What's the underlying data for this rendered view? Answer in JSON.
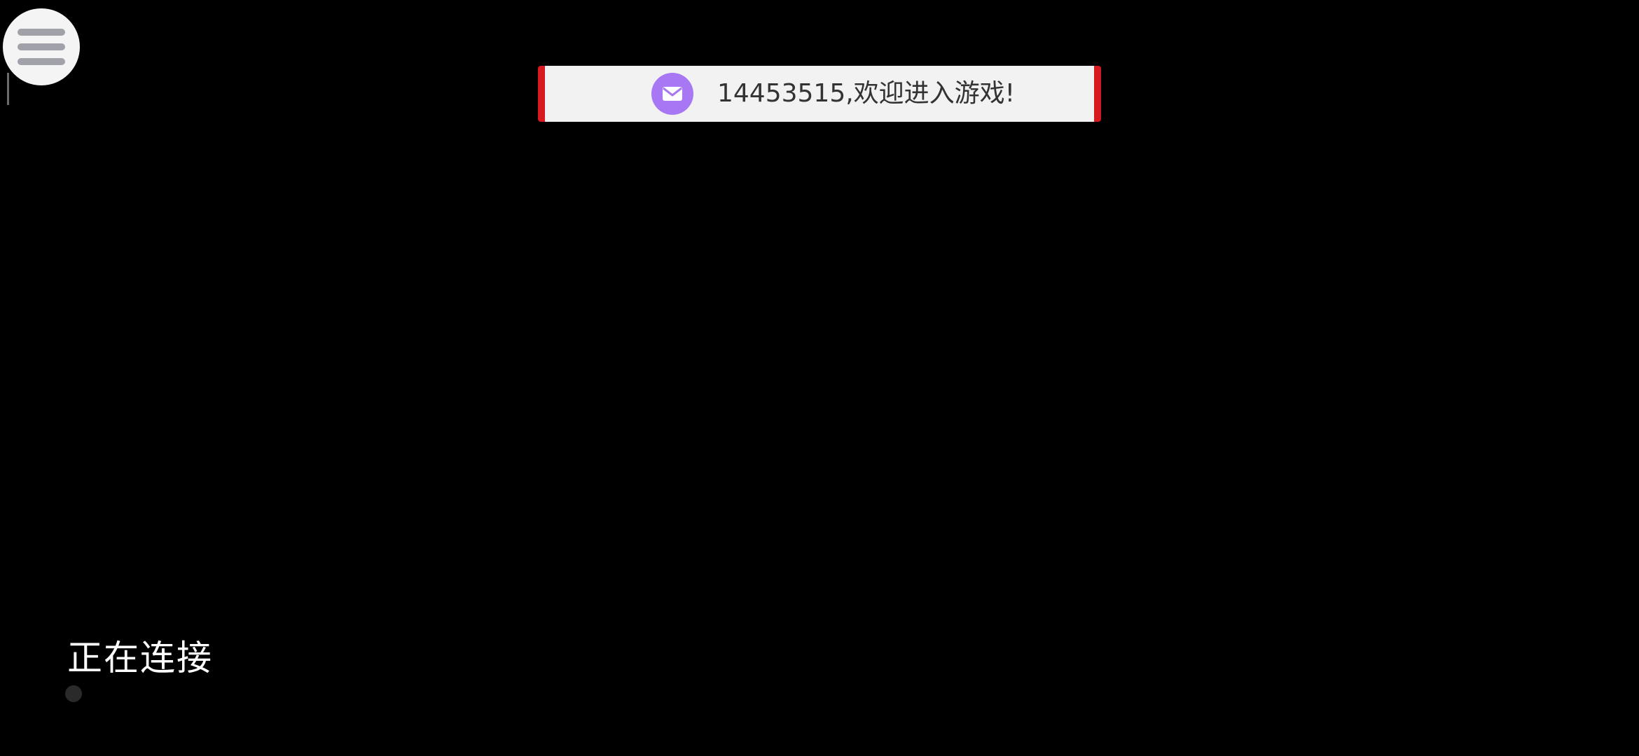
{
  "menu": {
    "icon": "hamburger-icon",
    "background": "#f4f4f4",
    "bar_color": "#a1a1a9"
  },
  "notification": {
    "icon": "mail-icon",
    "icon_color": "#a877f4",
    "accent": "#d71a20",
    "message": "14453515,欢迎进入游戏!"
  },
  "status": {
    "text": "正在连接"
  }
}
